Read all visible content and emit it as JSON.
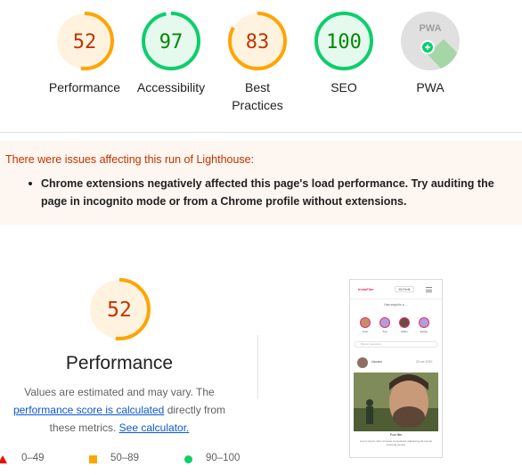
{
  "gauges": [
    {
      "label": "Performance",
      "score": "52",
      "value": 52,
      "color": "#ffa400",
      "bg": "#fff3e0",
      "text": "#c33300"
    },
    {
      "label": "Accessibility",
      "score": "97",
      "value": 97,
      "color": "#0cce6b",
      "bg": "#e6f9ee",
      "text": "#008800"
    },
    {
      "label": "Best Practices",
      "score": "83",
      "value": 83,
      "color": "#ffa400",
      "bg": "#fff3e0",
      "text": "#c33300"
    },
    {
      "label": "SEO",
      "score": "100",
      "value": 100,
      "color": "#0cce6b",
      "bg": "#e6f9ee",
      "text": "#008800"
    },
    {
      "label": "PWA",
      "badge": "PWA",
      "icon": "pwa-badge-icon"
    }
  ],
  "warning": {
    "title": "There were issues affecting this run of Lighthouse:",
    "item": "Chrome extensions negatively affected this page's load performance. Try auditing the page in incognito mode or from a Chrome profile without extensions."
  },
  "performance": {
    "score": "52",
    "value": 52,
    "title": "Performance",
    "desc_1": "Values are estimated and may vary. The",
    "link_calc": "performance score is calculated",
    "desc_2": "directly from these metrics.",
    "link_calculator": "See calculator."
  },
  "legend": [
    {
      "shape": "triangle",
      "range": "0–49",
      "color": "#eb0f00"
    },
    {
      "shape": "square",
      "range": "50–89",
      "color": "#ffa400"
    },
    {
      "shape": "circle",
      "range": "90–100",
      "color": "#0cce6b"
    }
  ],
  "thumbnail": {
    "logo": "InstaFilm",
    "button": "Mi Perfil",
    "followed_title": "Has seguido a ...",
    "followed": [
      "Juan",
      "Ana",
      "Mario",
      "Esther"
    ],
    "search_placeholder": "Buscar personas...",
    "post_user": "Usuario",
    "post_date": "20 oct 2020",
    "caption": "Post title",
    "text": "Lorem ipsum dolor sit amet consectetur adipiscing elit sed do eiusmod tempor"
  }
}
